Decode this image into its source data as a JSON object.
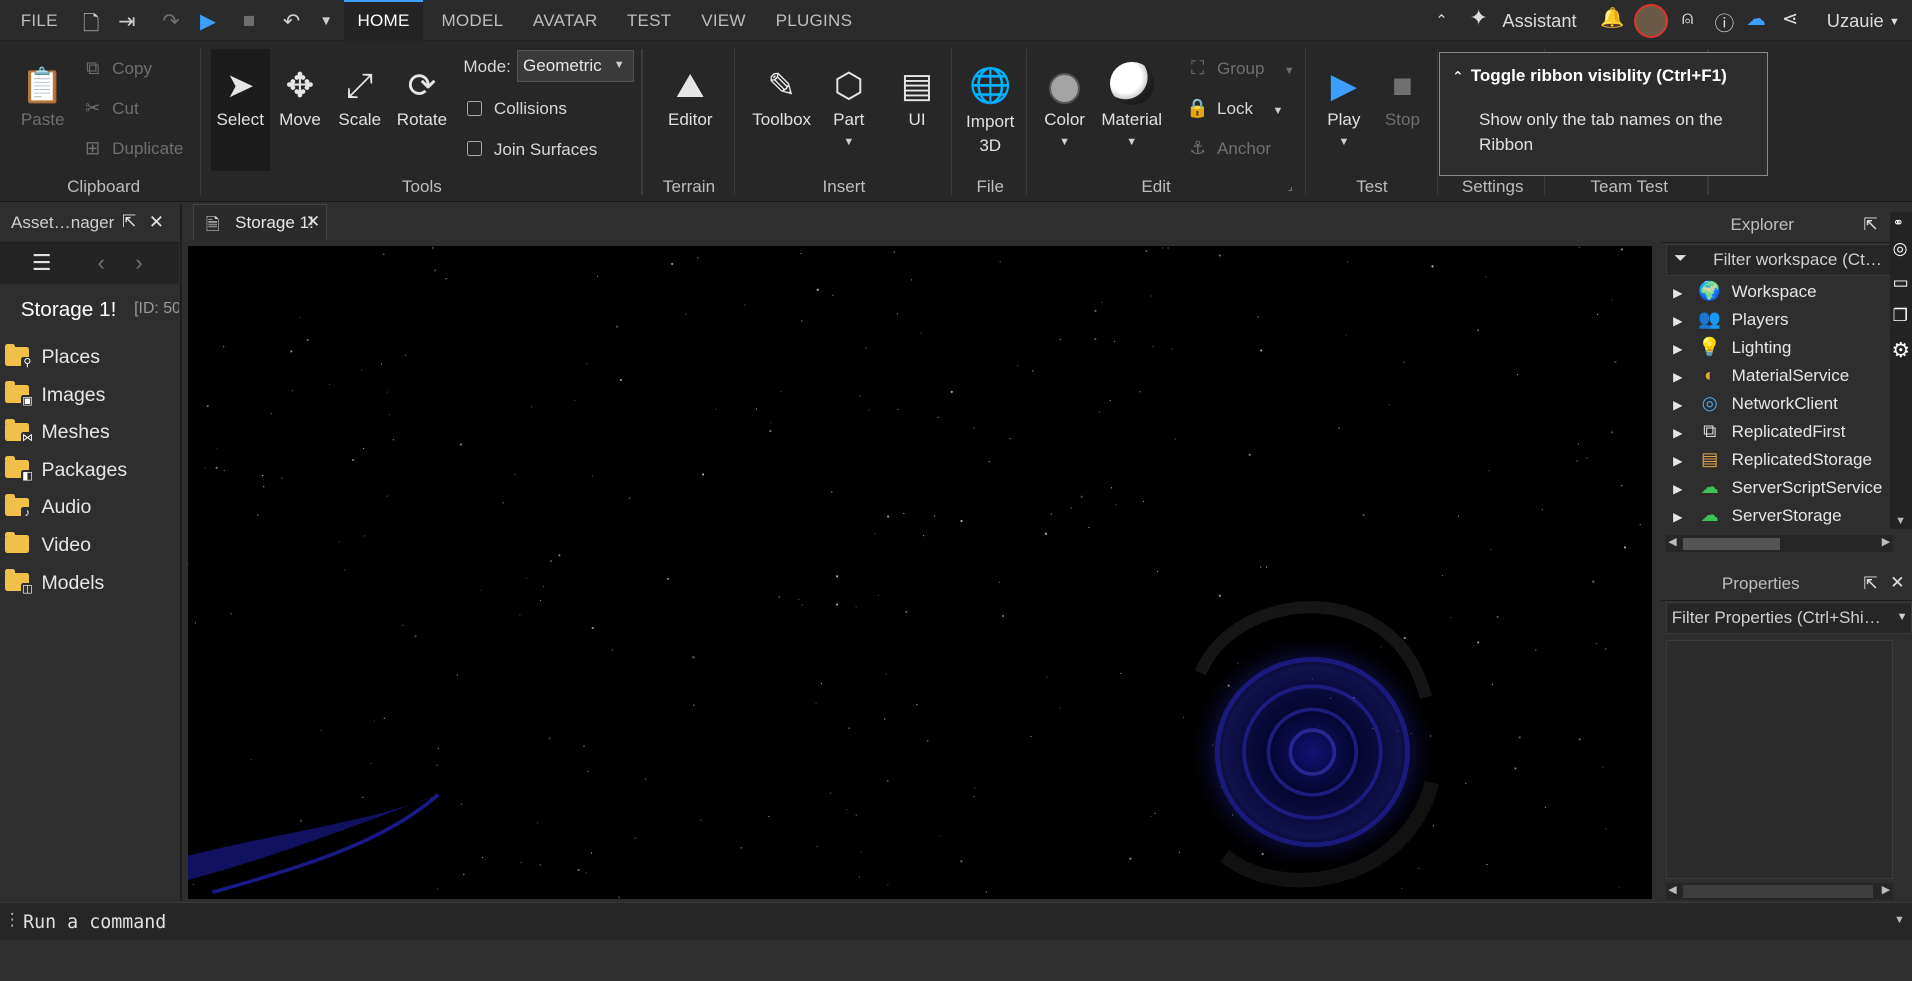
{
  "topbar": {
    "file_label": "FILE",
    "tabs": [
      "HOME",
      "MODEL",
      "AVATAR",
      "TEST",
      "VIEW",
      "PLUGINS"
    ],
    "assistant_label": "Assistant",
    "username": "Uzauie"
  },
  "ribbon": {
    "clipboard": {
      "paste": "Paste",
      "copy": "Copy",
      "cut": "Cut",
      "duplicate": "Duplicate",
      "label": "Clipboard"
    },
    "tools": {
      "select": "Select",
      "move": "Move",
      "scale": "Scale",
      "rotate": "Rotate",
      "mode_label": "Mode:",
      "mode_value": "Geometric",
      "collisions": "Collisions",
      "join_surfaces": "Join Surfaces",
      "label": "Tools"
    },
    "terrain": {
      "editor": "Editor",
      "label": "Terrain"
    },
    "insert": {
      "toolbox": "Toolbox",
      "part": "Part",
      "ui": "UI",
      "label": "Insert"
    },
    "file": {
      "import_line1": "Import",
      "import_line2": "3D",
      "label": "File"
    },
    "edit": {
      "color": "Color",
      "material": "Material",
      "group": "Group",
      "lock": "Lock",
      "anchor": "Anchor",
      "label": "Edit"
    },
    "test": {
      "play": "Play",
      "stop": "Stop",
      "label": "Test"
    },
    "settings_label": "Settings",
    "team_test_label": "Team Test"
  },
  "tooltip": {
    "title": "Toggle ribbon visiblity (Ctrl+F1)",
    "body_line1": "Show only the tab names on the",
    "body_line2": "Ribbon"
  },
  "asset_manager": {
    "tab_title": "Asset…nager",
    "storage_title": "Storage 1!",
    "storage_id": "[ID: 50",
    "items": [
      {
        "label": "Places",
        "badge": "⚲"
      },
      {
        "label": "Images",
        "badge": "▣"
      },
      {
        "label": "Meshes",
        "badge": "⋈"
      },
      {
        "label": "Packages",
        "badge": "◧"
      },
      {
        "label": "Audio",
        "badge": "♪"
      },
      {
        "label": "Video",
        "badge": ""
      },
      {
        "label": "Models",
        "badge": "◫"
      }
    ]
  },
  "viewport": {
    "tab_title": "Storage 1!"
  },
  "explorer": {
    "title": "Explorer",
    "filter_placeholder": "Filter workspace (Ct…",
    "items": [
      {
        "label": "Workspace",
        "icon": "🌍",
        "color": "#3b8fe8"
      },
      {
        "label": "Players",
        "icon": "👥",
        "color": "#e89b3b"
      },
      {
        "label": "Lighting",
        "icon": "💡",
        "color": "#f2d44a"
      },
      {
        "label": "MaterialService",
        "icon": "◐",
        "color": "#e0a64a"
      },
      {
        "label": "NetworkClient",
        "icon": "◎",
        "color": "#4aa8e8"
      },
      {
        "label": "ReplicatedFirst",
        "icon": "⧉",
        "color": "#dcdcdc"
      },
      {
        "label": "ReplicatedStorage",
        "icon": "▤",
        "color": "#e0a64a"
      },
      {
        "label": "ServerScriptService",
        "icon": "☁",
        "color": "#3fc15a"
      },
      {
        "label": "ServerStorage",
        "icon": "☁",
        "color": "#3fc15a"
      }
    ]
  },
  "properties": {
    "title": "Properties",
    "filter_placeholder": "Filter Properties (Ctrl+Shi…"
  },
  "command_bar": {
    "placeholder": "Run a command"
  }
}
